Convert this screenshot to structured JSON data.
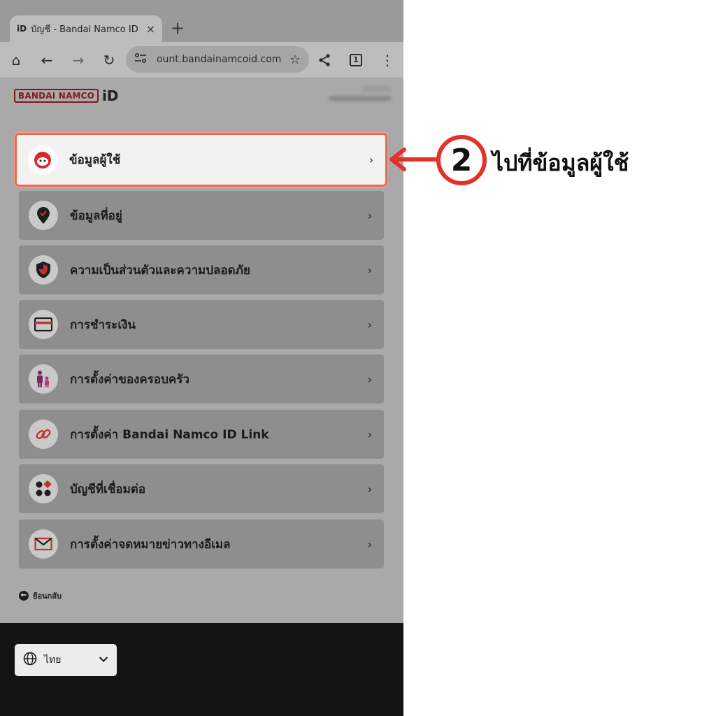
{
  "browser": {
    "tab": {
      "favicon": "iD",
      "title": "บัญชี - Bandai Namco ID",
      "close": "×"
    },
    "new_tab": "+",
    "toolbar": {
      "home": "⌂",
      "back": "←",
      "forward": "→",
      "reload": "↻",
      "url": "ount.bandainamcoid.com",
      "star": "☆",
      "share": "share-icon",
      "tab_count": "1",
      "menu": "⋮"
    }
  },
  "page": {
    "logo": {
      "brand": "BANDAI NAMCO",
      "id": "iD"
    },
    "menu": [
      {
        "label": "ข้อมูลผู้ใช้",
        "icon": "user-face-icon",
        "highlighted": true
      },
      {
        "label": "ข้อมูลที่อยู่",
        "icon": "location-pin-icon"
      },
      {
        "label": "ความเป็นส่วนตัวและความปลอดภัย",
        "icon": "shield-icon"
      },
      {
        "label": "การชำระเงิน",
        "icon": "credit-card-icon"
      },
      {
        "label": "การตั้งค่าของครอบครัว",
        "icon": "family-icon"
      },
      {
        "label": "การตั้งค่า Bandai Namco ID Link",
        "icon": "link-icon"
      },
      {
        "label": "บัญชีที่เชื่อมต่อ",
        "icon": "connected-accounts-icon"
      },
      {
        "label": "การตั้งค่าจดหมายข่าวทางอีเมล",
        "icon": "mail-icon"
      }
    ],
    "chevron": "›",
    "back_label": "ย้อนกลับ"
  },
  "footer": {
    "language": "ไทย"
  },
  "annotation": {
    "step": "2",
    "text": "ไปที่ข้อมูลผู้ใช้",
    "color": "#e4322b"
  }
}
